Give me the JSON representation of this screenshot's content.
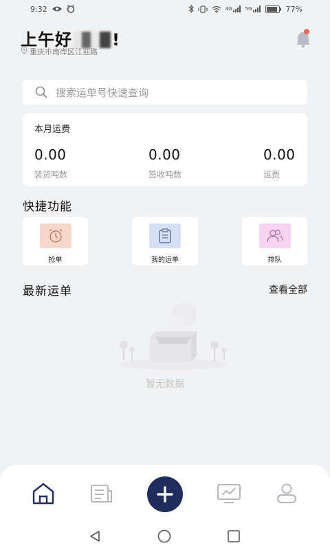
{
  "status_bar": {
    "time": "9:32",
    "network_4g": "4G",
    "network_5g": "5G",
    "battery": "77%"
  },
  "header": {
    "greeting_prefix": "上午好",
    "greeting_suffix": "!",
    "location": "重庆市南岸区江迎路",
    "notification_badge_color": "#e26b5c"
  },
  "search": {
    "placeholder": "搜索运单号快速查询"
  },
  "monthly_fee": {
    "title": "本月运费",
    "stats": [
      {
        "value": "0.00",
        "label": "装货吨数"
      },
      {
        "value": "0.00",
        "label": "签收吨数"
      },
      {
        "value": "0.00",
        "label": "运费"
      }
    ]
  },
  "quick_functions": {
    "title": "快捷功能",
    "items": [
      {
        "label": "抢单",
        "icon": "alarm-clock-icon",
        "color": "#f7d6cc"
      },
      {
        "label": "我的运单",
        "icon": "clipboard-icon",
        "color": "#d6e0f5"
      },
      {
        "label": "排队",
        "icon": "users-icon",
        "color": "#f8d3f2"
      }
    ]
  },
  "latest_waybills": {
    "title": "最新运单",
    "view_all": "查看全部",
    "empty_text": "暂无数据"
  },
  "tab_bar": {
    "items": [
      {
        "icon": "home-icon",
        "active": true
      },
      {
        "icon": "waybill-icon",
        "active": false
      },
      {
        "icon": "plus-icon",
        "active": false
      },
      {
        "icon": "monitor-chart-icon",
        "active": false
      },
      {
        "icon": "user-icon",
        "active": false
      }
    ],
    "accent_color": "#1e2d5e"
  },
  "system_nav": {
    "buttons": [
      "back-icon",
      "home-circle-icon",
      "recents-icon"
    ]
  }
}
